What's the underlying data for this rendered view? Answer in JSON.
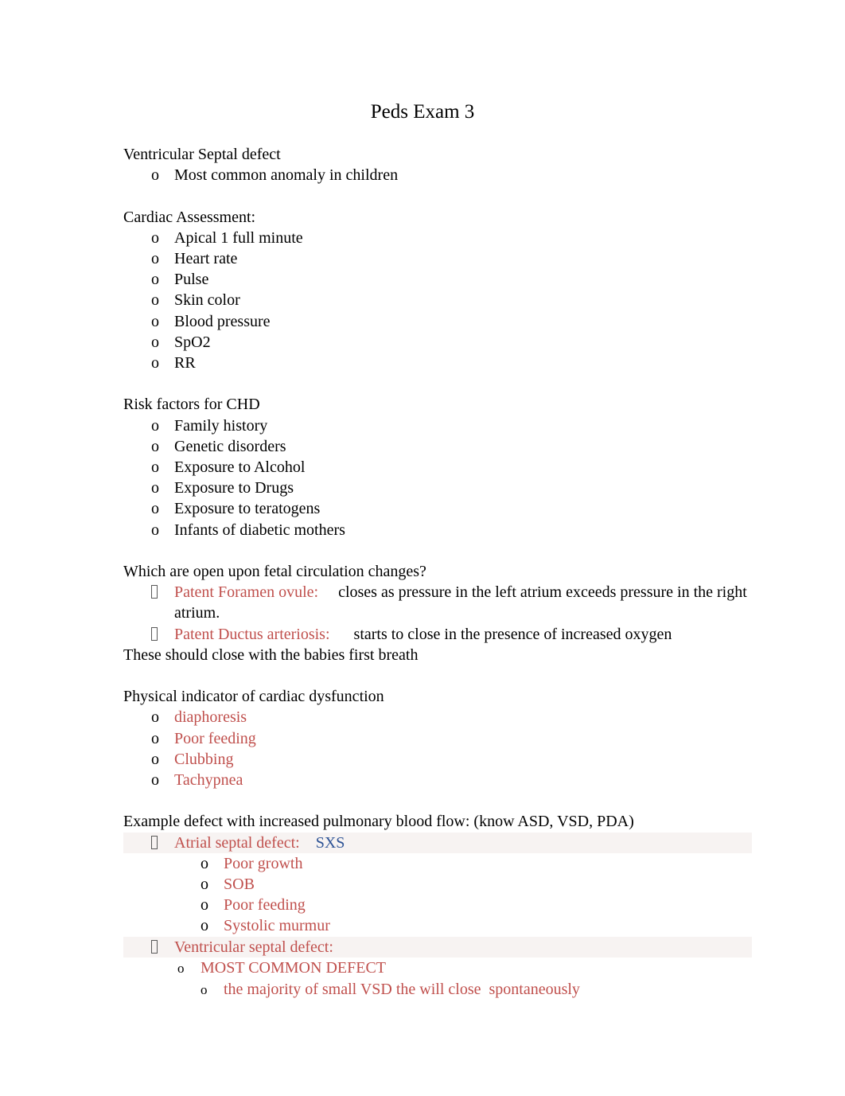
{
  "document": {
    "title": "Peds Exam 3",
    "colors": {
      "text": "#000000",
      "accent_red": "#C0504D",
      "accent_blue": "#2F5496",
      "page_background": "#ffffff",
      "bullet_box": "#595959"
    },
    "sections": [
      {
        "heading": "Ventricular Septal defect",
        "items": [
          {
            "bullet": "o",
            "text": "Most common anomaly in children",
            "color": "black"
          }
        ]
      },
      {
        "heading": "Cardiac Assessment:",
        "items": [
          {
            "bullet": "o",
            "text": "Apical 1 full minute",
            "color": "black"
          },
          {
            "bullet": "o",
            "text": "Heart rate",
            "color": "black"
          },
          {
            "bullet": "o",
            "text": "Pulse",
            "color": "black"
          },
          {
            "bullet": "o",
            "text": "Skin color",
            "color": "black"
          },
          {
            "bullet": "o",
            "text": "Blood pressure",
            "color": "black"
          },
          {
            "bullet": "o",
            "text": "SpO2",
            "color": "black"
          },
          {
            "bullet": "o",
            "text": "RR",
            "color": "black"
          }
        ]
      },
      {
        "heading": "Risk factors for CHD",
        "items": [
          {
            "bullet": "o",
            "text": "Family history",
            "color": "black"
          },
          {
            "bullet": "o",
            "text": "Genetic disorders",
            "color": "black"
          },
          {
            "bullet": "o",
            "text": "Exposure to Alcohol",
            "color": "black"
          },
          {
            "bullet": "o",
            "text": "Exposure to Drugs",
            "color": "black"
          },
          {
            "bullet": "o",
            "text": "Exposure to teratogens",
            "color": "black"
          },
          {
            "bullet": "o",
            "text": "Infants of diabetic mothers",
            "color": "black"
          }
        ]
      },
      {
        "heading": "Which are open upon fetal circulation changes?",
        "items": [
          {
            "bullet": "missing-glyph-box",
            "label": "Patent Foramen ovule:",
            "label_color": "red",
            "text": "closes as pressure in the left atrium exceeds pressure in the right atrium.",
            "color": "black"
          },
          {
            "bullet": "missing-glyph-box",
            "label": "Patent Ductus arteriosis:",
            "label_color": "red",
            "text": "starts to close in the presence of increased oxygen",
            "color": "black"
          }
        ],
        "trailing_line": "These should close with the babies first breath"
      },
      {
        "heading": "Physical indicator of cardiac dysfunction",
        "items": [
          {
            "bullet": "o",
            "text": "diaphoresis",
            "color": "red"
          },
          {
            "bullet": "o",
            "text": "Poor feeding",
            "color": "red"
          },
          {
            "bullet": "o",
            "text": "Clubbing",
            "color": "red"
          },
          {
            "bullet": "o",
            "text": "Tachypnea",
            "color": "red"
          }
        ]
      },
      {
        "heading": "Example defect with increased pulmonary blood flow: (know ASD, VSD, PDA)",
        "items": [
          {
            "bullet": "missing-glyph-box",
            "label": "Atrial septal defect:",
            "label_color": "red",
            "text": "SXS",
            "color": "blue"
          },
          {
            "bullet": "o",
            "text": "Poor growth",
            "color": "red",
            "level": 2
          },
          {
            "bullet": "o",
            "text": "SOB",
            "color": "red",
            "level": 2
          },
          {
            "bullet": "o",
            "text": "Poor feeding",
            "color": "red",
            "level": 2
          },
          {
            "bullet": "o",
            "text": "Systolic murmur",
            "color": "red",
            "level": 2
          },
          {
            "bullet": "missing-glyph-box",
            "label": "Ventricular septal defect:",
            "label_color": "red",
            "text": "",
            "color": "red"
          },
          {
            "bullet": "o",
            "text": "MOST COMMON DEFECT",
            "color": "red",
            "level": 2
          },
          {
            "bullet": "o",
            "text": "the majority of small VSD the will close  spontaneously",
            "color": "red",
            "level": 3
          }
        ]
      }
    ],
    "labels": {
      "bullet_o": "o",
      "tab_gap": "\t"
    }
  }
}
